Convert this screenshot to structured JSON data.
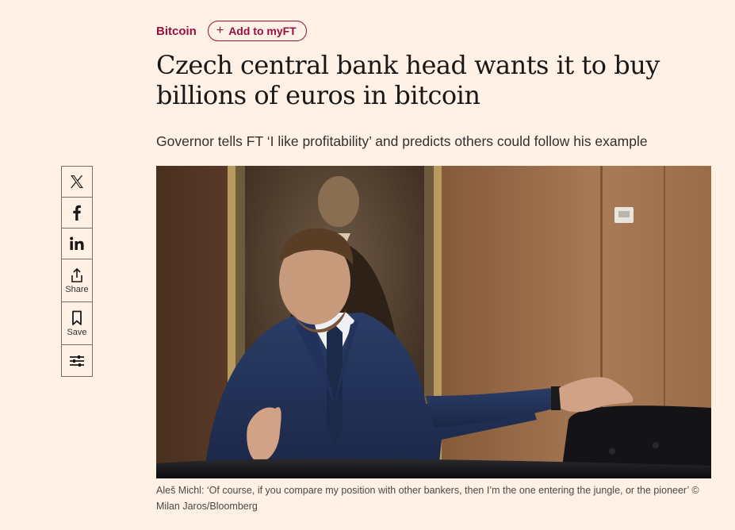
{
  "topic": {
    "label": "Bitcoin"
  },
  "myft": {
    "plus": "+",
    "label": "Add to myFT"
  },
  "headline": "Czech central bank head wants it to buy billions of euros in bitcoin",
  "standfirst": "Governor tells FT ‘I like profitability’ and predicts others could follow his example",
  "share": {
    "twitter_icon": "x-logo-icon",
    "facebook_icon": "facebook-icon",
    "linkedin_icon": "linkedin-icon",
    "share_label": "Share",
    "save_label": "Save",
    "settings_icon": "sliders-icon"
  },
  "image": {
    "description_icon": "article-photo"
  },
  "caption": "Aleš Michl: ‘Of course, if you compare my position with other bankers, then I’m the one entering the jungle, or the pioneer’ © Milan Jaros/Bloomberg",
  "colors": {
    "background": "#fff1e5",
    "accent": "#990f3d",
    "text": "#33302e"
  }
}
